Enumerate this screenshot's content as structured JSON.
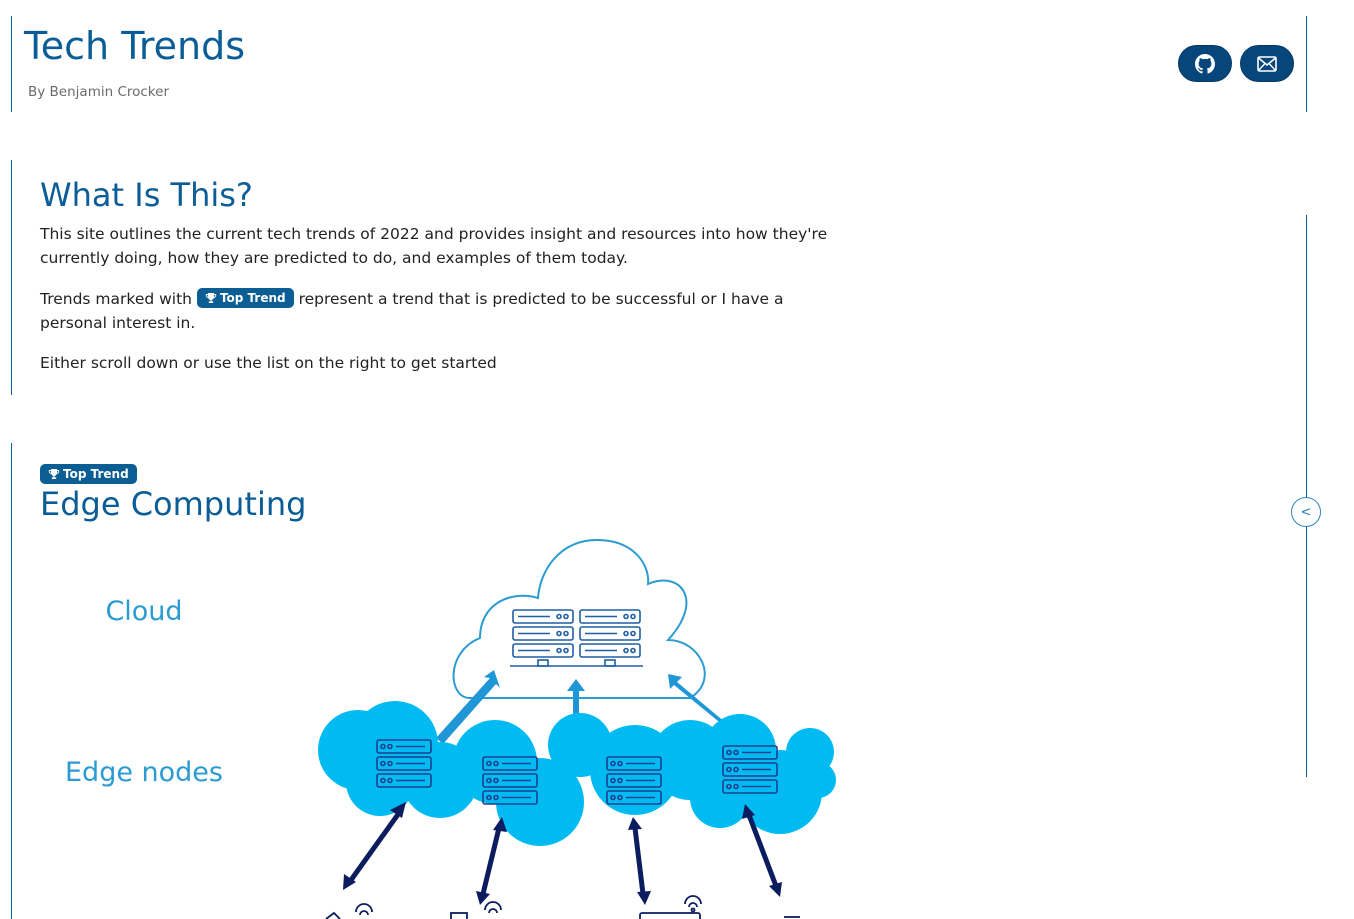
{
  "header": {
    "title": "Tech Trends",
    "byline": "By Benjamin Crocker",
    "buttons": [
      {
        "icon": "github-icon"
      },
      {
        "icon": "mail-icon"
      }
    ]
  },
  "intro": {
    "title": "What Is This?",
    "paragraph1": "This site outlines the current tech trends of 2022 and provides insight and resources into how they're currently doing, how they are predicted to do, and examples of them today.",
    "paragraph2_before": "Trends marked with",
    "paragraph2_after": "represent a trend that is predicted to be successful or I have a personal interest in.",
    "paragraph3": "Either scroll down or use the list on the right to get started"
  },
  "badge": {
    "label": "Top Trend",
    "icon": "trophy-icon"
  },
  "edge": {
    "title": "Edge Computing",
    "diagram": {
      "cloud_label": "Cloud",
      "edge_label": "Edge nodes"
    }
  },
  "toc": {
    "toggle_label": "<"
  },
  "colors": {
    "brand": "#0a5d96",
    "button_bg": "#07467a",
    "cloud_outline": "#2b9bd2",
    "edge_cloud": "#00bbf2",
    "arrow_dark": "#0b1d5e"
  }
}
